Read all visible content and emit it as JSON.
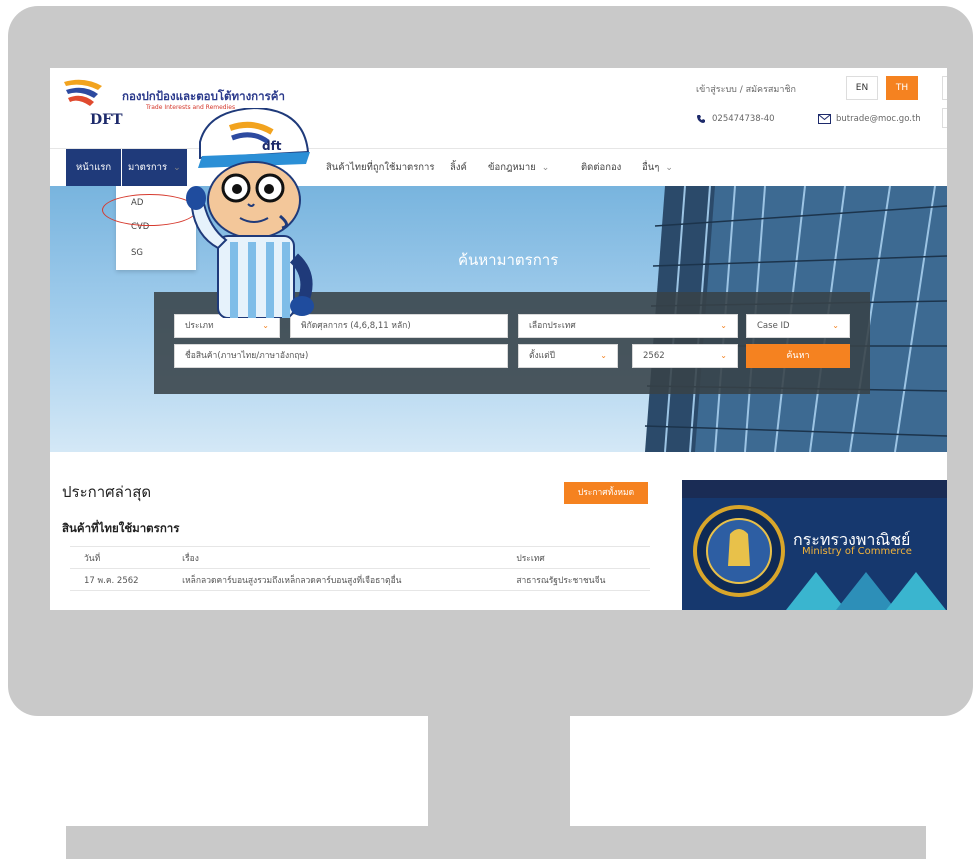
{
  "site": {
    "logo_text_th": "กองปกป้องและตอบโต้ทางการค้า",
    "logo_text_en": "Trade Interests and Remedies",
    "logo_abbr": "DFT",
    "mascot_cap_text": "dft"
  },
  "header": {
    "login_link": "เข้าสู่ระบบ / สมัครสมาชิก",
    "lang_en": "EN",
    "lang_th": "TH",
    "phone": "025474738-40",
    "email": "butrade@moc.go.th"
  },
  "nav": {
    "home": "หน้าแรก",
    "measures": "มาตรการ",
    "thai_goods": "สินค้าไทยที่ถูกใช้มาตรการ",
    "links": "ลิ้งค์",
    "law": "ข้อกฎหมาย",
    "contact": "ติดต่อกอง",
    "other": "อื่นๆ",
    "dropdown": [
      "AD",
      "CVD",
      "SG"
    ]
  },
  "hero": {
    "title": "ค้นหามาตรการ"
  },
  "search": {
    "type_select": "ประเภท",
    "tariff_placeholder": "พิกัดศุลกากร (4,6,8,11 หลัก)",
    "country_select": "เลือกประเทศ",
    "case_id_select": "Case ID",
    "product_placeholder": "ชื่อสินค้า(ภาษาไทย/ภาษาอังกฤษ)",
    "since_select": "ตั้งแต่ปี",
    "year_select": "2562",
    "search_button": "ค้นหา"
  },
  "news": {
    "heading": "ประกาศล่าสุด",
    "all_button": "ประกาศทั้งหมด",
    "subheading": "สินค้าที่ไทยใช้มาตรการ",
    "columns": [
      "วันที่",
      "เรื่อง",
      "ประเทศ"
    ],
    "rows": [
      [
        "17 พ.ค. 2562",
        "เหล็กลวดคาร์บอนสูงรวมถึงเหล็กลวดคาร์บอนสูงที่เจือธาตุอื่น",
        "สาธารณรัฐประชาชนจีน"
      ]
    ]
  },
  "banner": {
    "title_th": "กระทรวงพาณิชย์",
    "title_en": "Ministry of Commerce"
  },
  "colors": {
    "accent": "#f58220",
    "nav_active": "#1f3a7a",
    "frame": "#c9c9c9"
  }
}
